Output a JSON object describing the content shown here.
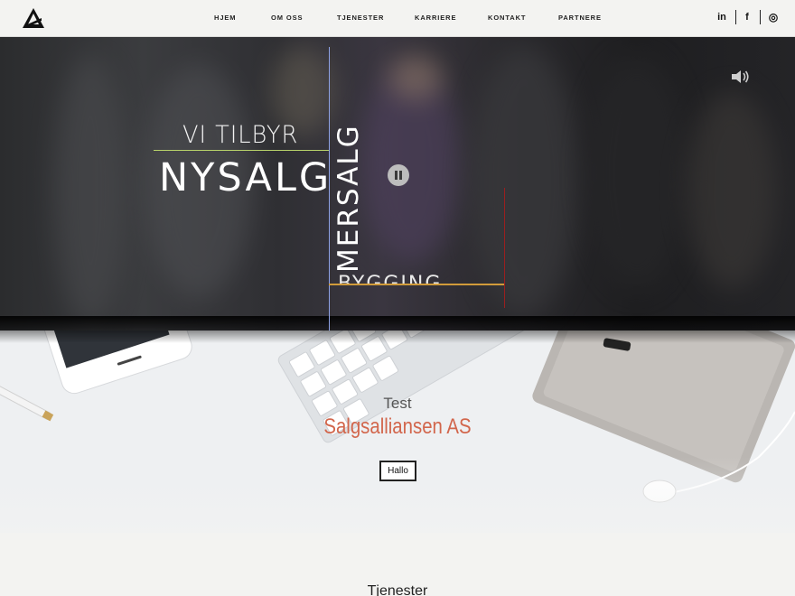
{
  "nav": {
    "items": [
      {
        "label": "HJEM"
      },
      {
        "label": "OM OSS"
      },
      {
        "label": "TJENESTER"
      },
      {
        "label": "KARRIERE"
      },
      {
        "label": "KONTAKT"
      },
      {
        "label": "PARTNERE"
      }
    ],
    "social": [
      {
        "icon": "linkedin-icon",
        "glyph": "in"
      },
      {
        "icon": "facebook-icon",
        "glyph": "f"
      },
      {
        "icon": "instagram-icon",
        "glyph": "◎"
      }
    ]
  },
  "hero": {
    "line1": "VI TILBYR",
    "line2": "NYSALG",
    "vertical": "MERSALG",
    "partial": "BYGGING"
  },
  "banner": {
    "subtitle": "Test",
    "title": "Salgsalliansen AS",
    "button_label": "Hallo"
  },
  "section": {
    "title": "Tjenester"
  },
  "colors": {
    "accent": "#d2664c",
    "line_green": "#b9d36a",
    "line_blue": "#8fa3e6",
    "line_orange": "#d19b3a",
    "line_red": "#9a1f1f"
  }
}
